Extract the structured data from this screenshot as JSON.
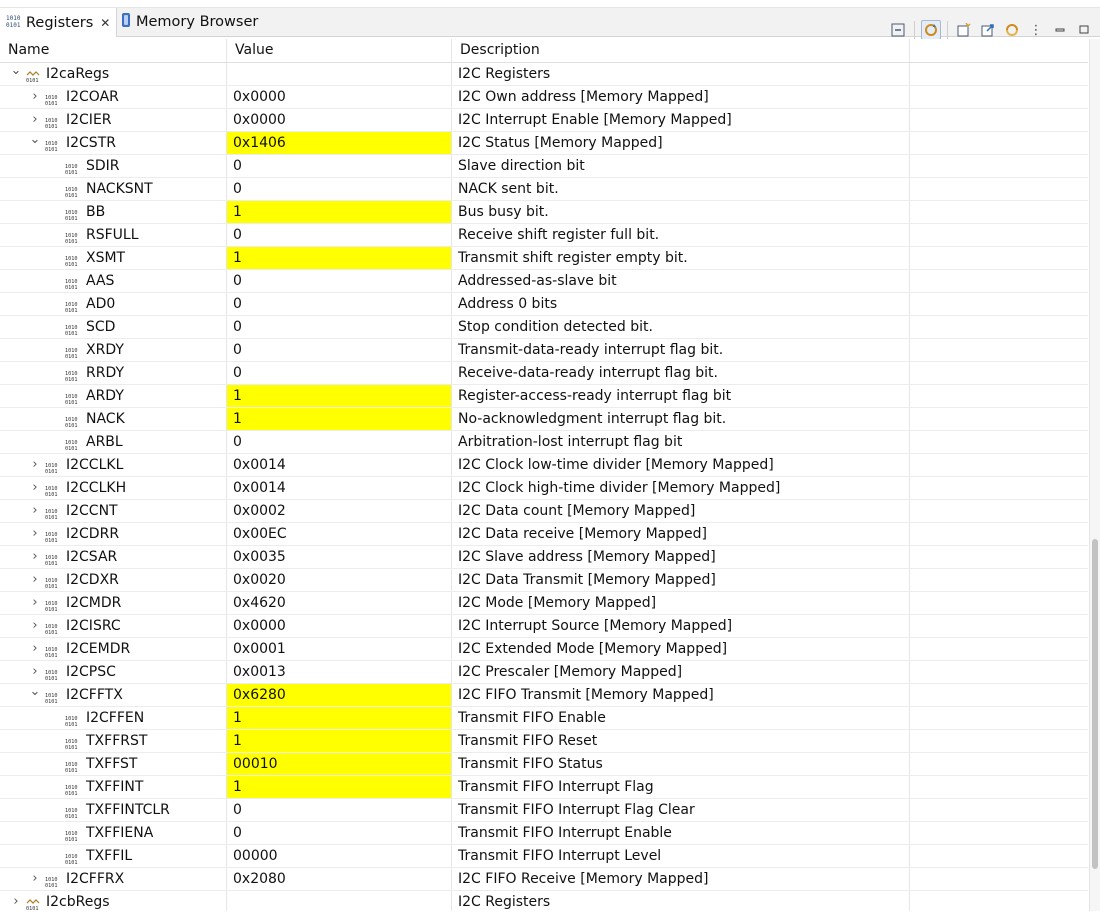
{
  "tabs": [
    {
      "label": "Registers",
      "active": true,
      "closable": true,
      "icon": "register-icon"
    },
    {
      "label": "Memory Browser",
      "active": false,
      "closable": false,
      "icon": "memory-icon"
    }
  ],
  "toolbar": {
    "icons": [
      "collapse-all-icon",
      "continuous-refresh-icon",
      "new-group-icon",
      "export-icon",
      "refresh-icon",
      "view-menu-icon",
      "minimize-icon",
      "maximize-icon"
    ]
  },
  "columns": {
    "name": "Name",
    "value": "Value",
    "description": "Description"
  },
  "colors": {
    "highlight": "#ffff00"
  },
  "rows": [
    {
      "name": "I2caRegs",
      "value": "",
      "description": "I2C Registers",
      "level": 0,
      "expand": "open",
      "kind": "group",
      "hl": false
    },
    {
      "name": "I2COAR",
      "value": "0x0000",
      "description": "I2C Own address  [Memory Mapped]",
      "level": 1,
      "expand": "closed",
      "kind": "reg",
      "hl": false
    },
    {
      "name": "I2CIER",
      "value": "0x0000",
      "description": "I2C Interrupt Enable  [Memory Mapped]",
      "level": 1,
      "expand": "closed",
      "kind": "reg",
      "hl": false
    },
    {
      "name": "I2CSTR",
      "value": "0x1406",
      "description": "I2C Status [Memory Mapped]",
      "level": 1,
      "expand": "open",
      "kind": "reg",
      "hl": true
    },
    {
      "name": "SDIR",
      "value": "0",
      "description": "Slave direction bit",
      "level": 2,
      "expand": "none",
      "kind": "reg",
      "hl": false
    },
    {
      "name": "NACKSNT",
      "value": "0",
      "description": "NACK sent bit.",
      "level": 2,
      "expand": "none",
      "kind": "reg",
      "hl": false
    },
    {
      "name": "BB",
      "value": "1",
      "description": "Bus busy bit.",
      "level": 2,
      "expand": "none",
      "kind": "reg",
      "hl": true
    },
    {
      "name": "RSFULL",
      "value": "0",
      "description": "Receive shift register full bit.",
      "level": 2,
      "expand": "none",
      "kind": "reg",
      "hl": false
    },
    {
      "name": "XSMT",
      "value": "1",
      "description": "Transmit shift register empty bit.",
      "level": 2,
      "expand": "none",
      "kind": "reg",
      "hl": true
    },
    {
      "name": "AAS",
      "value": "0",
      "description": "Addressed-as-slave bit",
      "level": 2,
      "expand": "none",
      "kind": "reg",
      "hl": false
    },
    {
      "name": "AD0",
      "value": "0",
      "description": "Address 0 bits",
      "level": 2,
      "expand": "none",
      "kind": "reg",
      "hl": false
    },
    {
      "name": "SCD",
      "value": "0",
      "description": "Stop condition detected bit.",
      "level": 2,
      "expand": "none",
      "kind": "reg",
      "hl": false
    },
    {
      "name": "XRDY",
      "value": "0",
      "description": "Transmit-data-ready interrupt flag bit.",
      "level": 2,
      "expand": "none",
      "kind": "reg",
      "hl": false
    },
    {
      "name": "RRDY",
      "value": "0",
      "description": "Receive-data-ready interrupt flag bit.",
      "level": 2,
      "expand": "none",
      "kind": "reg",
      "hl": false
    },
    {
      "name": "ARDY",
      "value": "1",
      "description": "Register-access-ready interrupt flag bit",
      "level": 2,
      "expand": "none",
      "kind": "reg",
      "hl": true
    },
    {
      "name": "NACK",
      "value": "1",
      "description": "No-acknowledgment interrupt flag bit.",
      "level": 2,
      "expand": "none",
      "kind": "reg",
      "hl": true
    },
    {
      "name": "ARBL",
      "value": "0",
      "description": "Arbitration-lost interrupt flag bit",
      "level": 2,
      "expand": "none",
      "kind": "reg",
      "hl": false
    },
    {
      "name": "I2CCLKL",
      "value": "0x0014",
      "description": "I2C Clock low-time divider  [Memory Mapped]",
      "level": 1,
      "expand": "closed",
      "kind": "reg",
      "hl": false
    },
    {
      "name": "I2CCLKH",
      "value": "0x0014",
      "description": "I2C Clock high-time divider  [Memory Mapped]",
      "level": 1,
      "expand": "closed",
      "kind": "reg",
      "hl": false
    },
    {
      "name": "I2CCNT",
      "value": "0x0002",
      "description": "I2C Data count [Memory Mapped]",
      "level": 1,
      "expand": "closed",
      "kind": "reg",
      "hl": false
    },
    {
      "name": "I2CDRR",
      "value": "0x00EC",
      "description": "I2C Data receive [Memory Mapped]",
      "level": 1,
      "expand": "closed",
      "kind": "reg",
      "hl": false
    },
    {
      "name": "I2CSAR",
      "value": "0x0035",
      "description": "I2C Slave address [Memory Mapped]",
      "level": 1,
      "expand": "closed",
      "kind": "reg",
      "hl": false
    },
    {
      "name": "I2CDXR",
      "value": "0x0020",
      "description": "I2C Data Transmit  [Memory Mapped]",
      "level": 1,
      "expand": "closed",
      "kind": "reg",
      "hl": false
    },
    {
      "name": "I2CMDR",
      "value": "0x4620",
      "description": "I2C Mode  [Memory Mapped]",
      "level": 1,
      "expand": "closed",
      "kind": "reg",
      "hl": false
    },
    {
      "name": "I2CISRC",
      "value": "0x0000",
      "description": "I2C Interrupt Source [Memory Mapped]",
      "level": 1,
      "expand": "closed",
      "kind": "reg",
      "hl": false
    },
    {
      "name": "I2CEMDR",
      "value": "0x0001",
      "description": "I2C Extended Mode  [Memory Mapped]",
      "level": 1,
      "expand": "closed",
      "kind": "reg",
      "hl": false
    },
    {
      "name": "I2CPSC",
      "value": "0x0013",
      "description": "I2C Prescaler  [Memory Mapped]",
      "level": 1,
      "expand": "closed",
      "kind": "reg",
      "hl": false
    },
    {
      "name": "I2CFFTX",
      "value": "0x6280",
      "description": "I2C FIFO Transmit  [Memory Mapped]",
      "level": 1,
      "expand": "open",
      "kind": "reg",
      "hl": true
    },
    {
      "name": "I2CFFEN",
      "value": "1",
      "description": "Transmit FIFO Enable",
      "level": 2,
      "expand": "none",
      "kind": "reg",
      "hl": true
    },
    {
      "name": "TXFFRST",
      "value": "1",
      "description": "Transmit FIFO Reset",
      "level": 2,
      "expand": "none",
      "kind": "reg",
      "hl": true
    },
    {
      "name": "TXFFST",
      "value": "00010",
      "description": "Transmit FIFO Status",
      "level": 2,
      "expand": "none",
      "kind": "reg",
      "hl": true
    },
    {
      "name": "TXFFINT",
      "value": "1",
      "description": "Transmit FIFO Interrupt Flag",
      "level": 2,
      "expand": "none",
      "kind": "reg",
      "hl": true
    },
    {
      "name": "TXFFINTCLR",
      "value": "0",
      "description": "Transmit FIFO Interrupt Flag Clear",
      "level": 2,
      "expand": "none",
      "kind": "reg",
      "hl": false
    },
    {
      "name": "TXFFIENA",
      "value": "0",
      "description": "Transmit FIFO Interrupt Enable",
      "level": 2,
      "expand": "none",
      "kind": "reg",
      "hl": false
    },
    {
      "name": "TXFFIL",
      "value": "00000",
      "description": "Transmit FIFO Interrupt Level",
      "level": 2,
      "expand": "none",
      "kind": "reg",
      "hl": false
    },
    {
      "name": "I2CFFRX",
      "value": "0x2080",
      "description": "I2C FIFO Receive  [Memory Mapped]",
      "level": 1,
      "expand": "closed",
      "kind": "reg",
      "hl": false
    },
    {
      "name": "I2cbRegs",
      "value": "",
      "description": "I2C Registers",
      "level": 0,
      "expand": "closed",
      "kind": "group",
      "hl": false
    }
  ]
}
